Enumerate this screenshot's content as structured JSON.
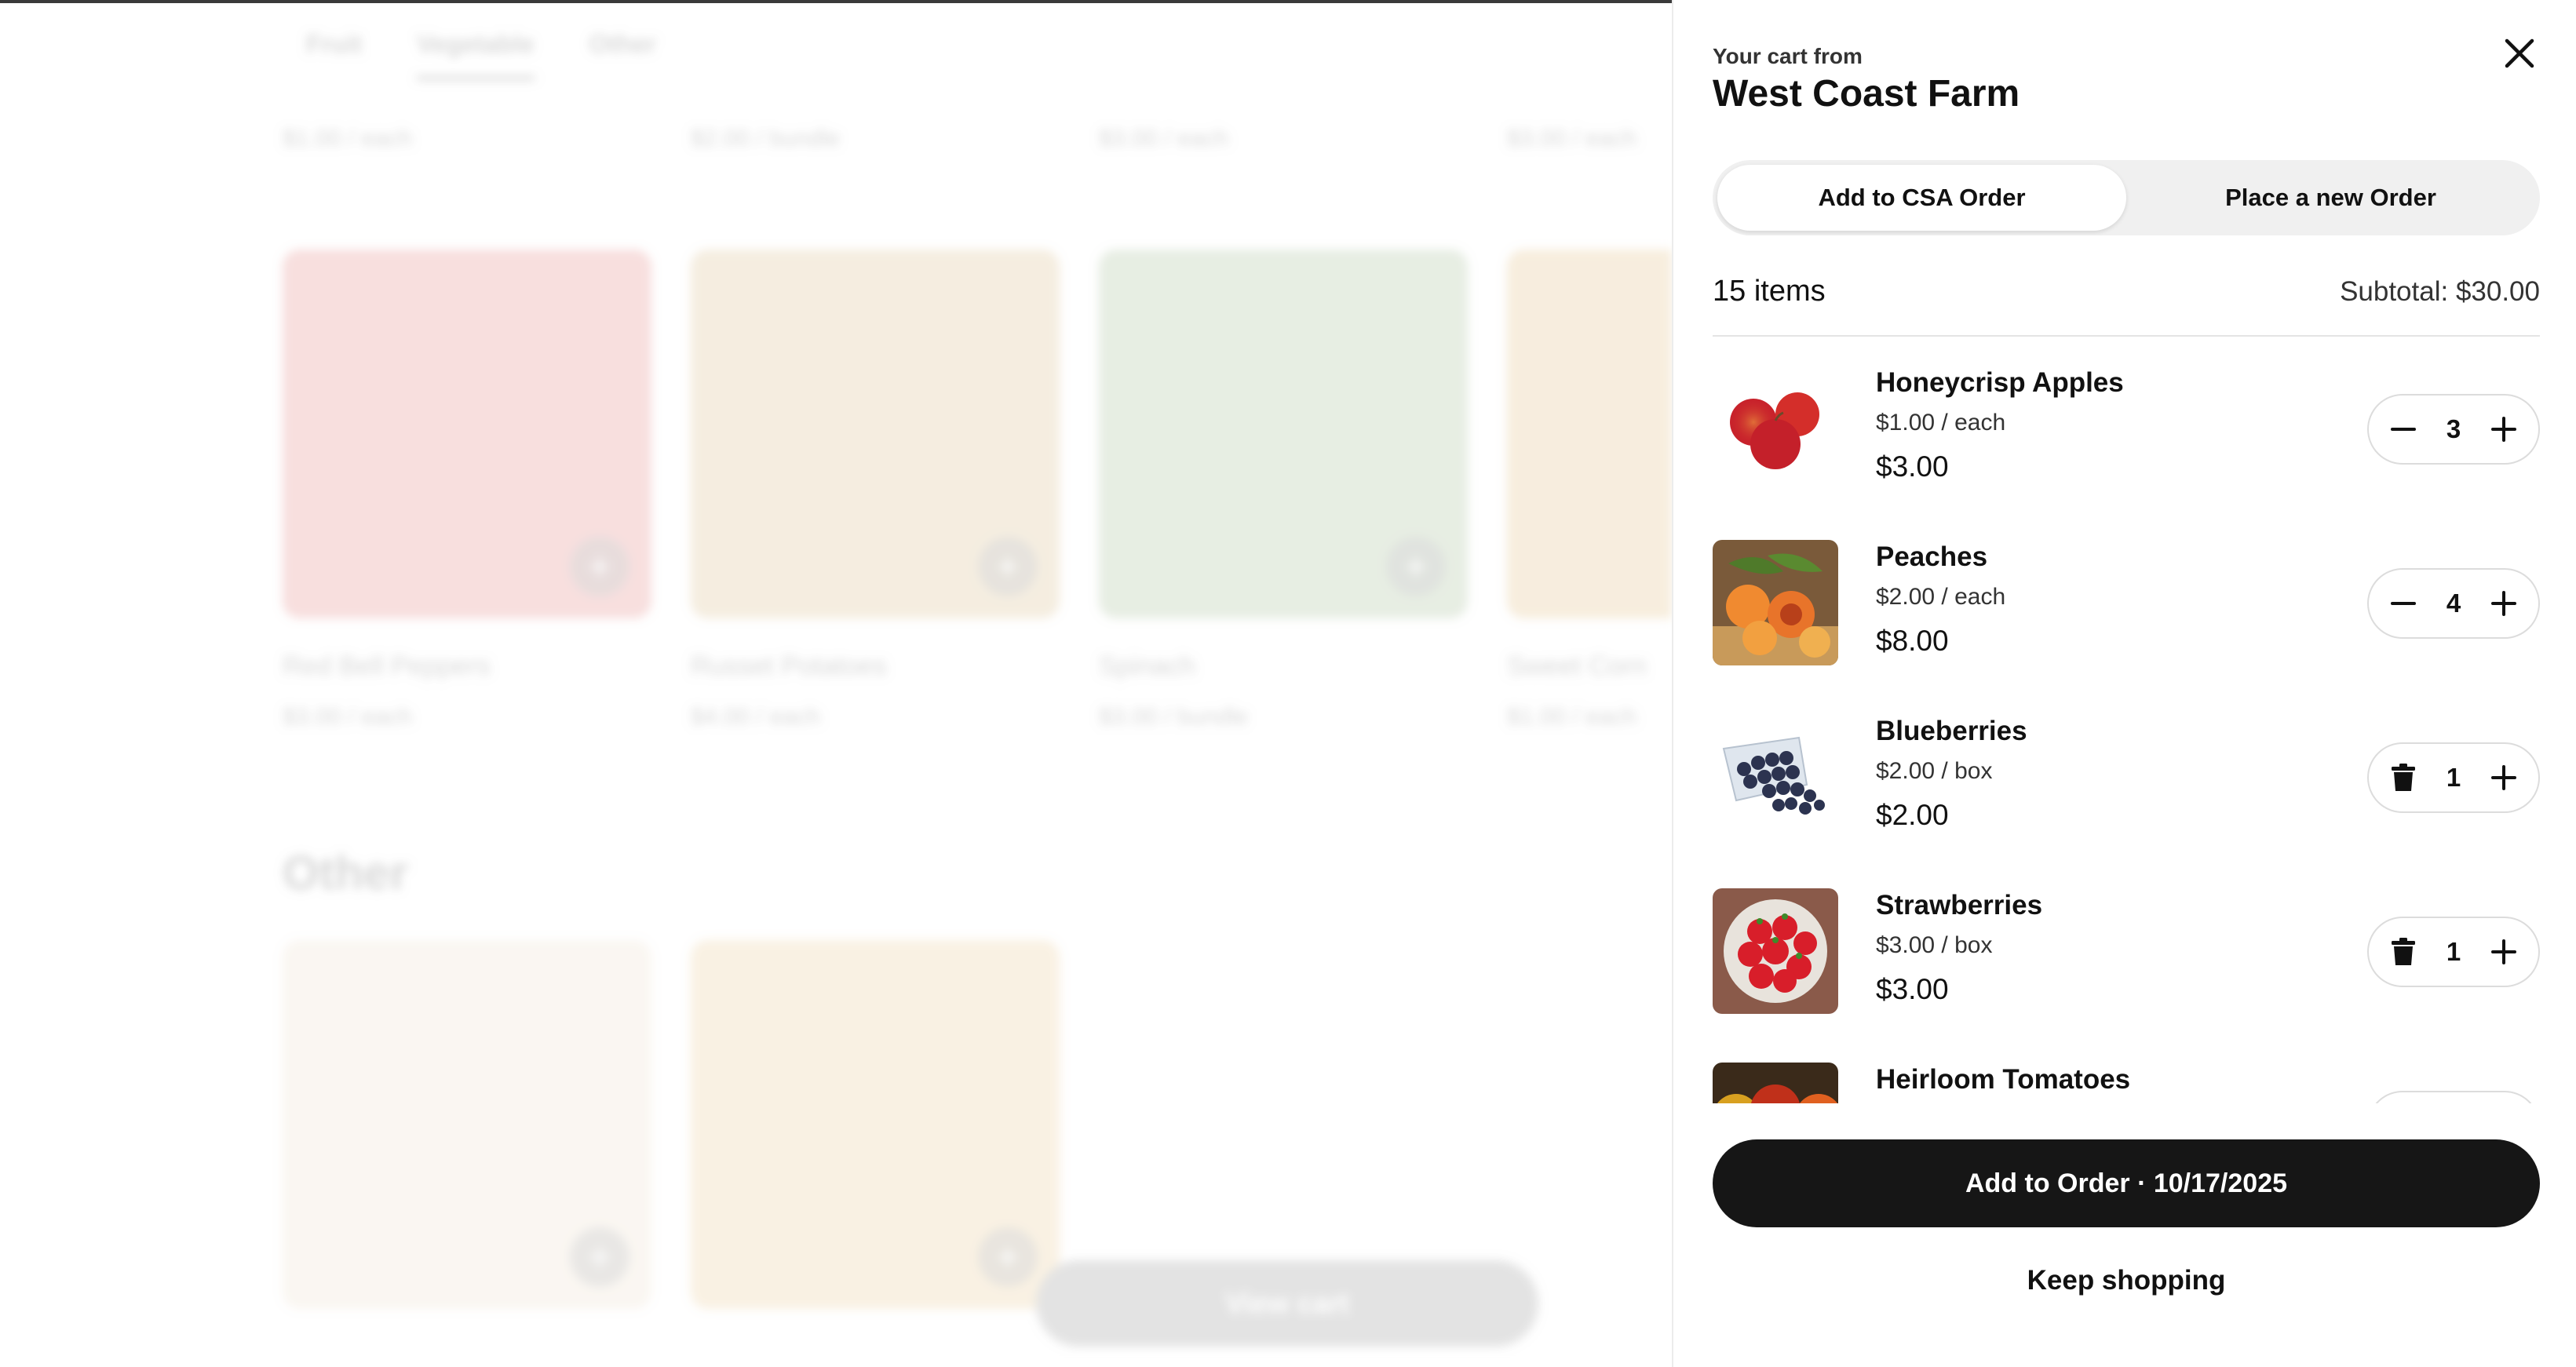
{
  "background": {
    "category_tabs": [
      "Fruit",
      "Vegetable",
      "Other"
    ],
    "top_row_prices": [
      "$1.00 / each",
      "$2.00 / bundle",
      "$3.00 / each",
      "$3.00 / each"
    ],
    "products": [
      {
        "name": "Red Bell Peppers",
        "price": "$3.00 / each",
        "color": "#d9534f"
      },
      {
        "name": "Russet Potatoes",
        "price": "$4.00 / each",
        "color": "#caa25a"
      },
      {
        "name": "Spinach",
        "price": "$3.00 / bundle",
        "color": "#7fa36a"
      },
      {
        "name": "Sweet Corn",
        "price": "$1.00 / each",
        "color": "#d6a24a"
      }
    ],
    "other_section_title": "Other",
    "other_products": [
      {
        "color": "#e6d3b8"
      },
      {
        "color": "#e2b66a"
      }
    ],
    "view_cart_label": "View cart"
  },
  "cart": {
    "cart_from_label": "Your cart from",
    "farm_name": "West Coast Farm",
    "order_modes": [
      {
        "label": "Add to CSA Order",
        "active": true
      },
      {
        "label": "Place a new Order",
        "active": false
      }
    ],
    "item_count": "15 items",
    "subtotal": "Subtotal: $30.00",
    "items": [
      {
        "name": "Honeycrisp Apples",
        "unit_price": "$1.00 / each",
        "total": "$3.00",
        "quantity": "3",
        "left_control": "minus-icon",
        "image": "apples"
      },
      {
        "name": "Peaches",
        "unit_price": "$2.00 / each",
        "total": "$8.00",
        "quantity": "4",
        "left_control": "minus-icon",
        "image": "peaches"
      },
      {
        "name": "Blueberries",
        "unit_price": "$2.00 / box",
        "total": "$2.00",
        "quantity": "1",
        "left_control": "trash-icon",
        "image": "blueberries"
      },
      {
        "name": "Strawberries",
        "unit_price": "$3.00 / box",
        "total": "$3.00",
        "quantity": "1",
        "left_control": "trash-icon",
        "image": "strawberries"
      },
      {
        "name": "Heirloom Tomatoes",
        "unit_price": "",
        "total": "",
        "quantity": "",
        "left_control": "",
        "image": "tomatoes"
      }
    ],
    "primary_button_label": "Add to Order · 10/17/2025",
    "keep_shopping_label": "Keep shopping"
  }
}
